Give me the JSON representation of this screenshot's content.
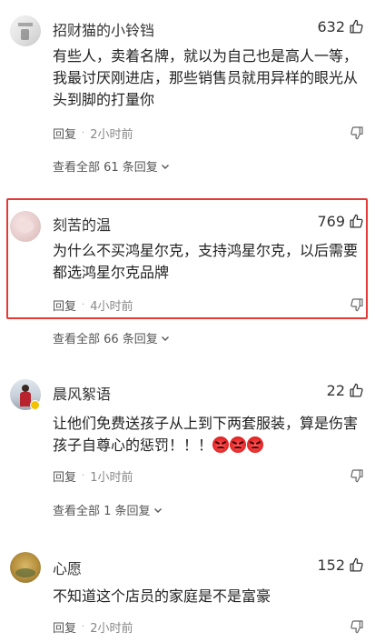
{
  "comments": [
    {
      "username": "招财猫的小铃铛",
      "likes": "632",
      "text": "有些人，卖着名牌，就以为自己也是高人一等，我最讨厌刚进店，那些销售员就用异样的眼光从头到脚的打量你",
      "reply_label": "回复",
      "time": "2小时前",
      "view_all": "查看全部 61 条回复"
    },
    {
      "username": "刻苦的温",
      "likes": "769",
      "text": "为什么不买鸿星尔克，支持鸿星尔克，以后需要都选鸿星尔克品牌",
      "reply_label": "回复",
      "time": "4小时前",
      "view_all": "查看全部 66 条回复"
    },
    {
      "username": "晨风絮语",
      "likes": "22",
      "text": "让他们免费送孩子从上到下两套服装，算是伤害孩子自尊心的惩罚！！！",
      "reply_label": "回复",
      "time": "1小时前",
      "view_all": "查看全部 1 条回复"
    },
    {
      "username": "心愿",
      "likes": "152",
      "text": "不知道这个店员的家庭是不是富豪",
      "reply_label": "回复",
      "time": "2小时前"
    }
  ],
  "icons": {
    "like": "thumbs-up-icon",
    "dislike": "thumbs-down-icon",
    "expand": "chevron-down-icon",
    "emoji": "angry-face-emoji"
  },
  "colors": {
    "highlight": "#e53935"
  }
}
